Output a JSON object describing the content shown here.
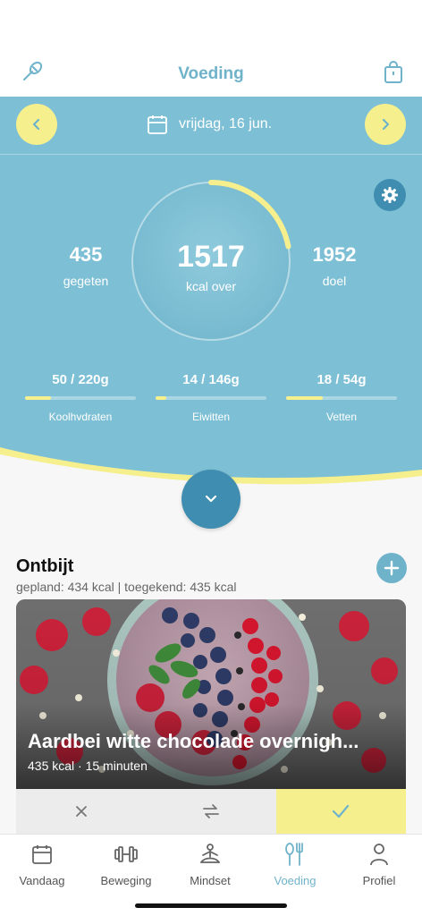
{
  "header": {
    "title": "Voeding",
    "left_icon": "whisk-icon",
    "right_icon": "shopping-bag-icon"
  },
  "date_nav": {
    "label": "vrijdag, 16 jun.",
    "prev_icon": "chevron-left-icon",
    "next_icon": "chevron-right-icon",
    "calendar_icon": "calendar-icon"
  },
  "summary": {
    "eaten_value": "435",
    "eaten_label": "gegeten",
    "remaining_value": "1517",
    "remaining_label": "kcal over",
    "goal_value": "1952",
    "goal_label": "doel",
    "progress_fraction": 0.22
  },
  "macros": [
    {
      "value": "50 / 220g",
      "label": "Koolhydraten",
      "fraction": 0.23
    },
    {
      "value": "14 / 146g",
      "label": "Eiwitten",
      "fraction": 0.1
    },
    {
      "value": "18 / 54g",
      "label": "Vetten",
      "fraction": 0.33
    }
  ],
  "meal": {
    "title": "Ontbijt",
    "subtitle": "gepland: 434 kcal | toegekend: 435 kcal",
    "recipe": {
      "title": "Aardbei witte chocolade overnigh...",
      "meta": "435 kcal · 15 minuten"
    }
  },
  "tabs": [
    {
      "label": "Vandaag",
      "icon": "calendar-icon"
    },
    {
      "label": "Beweging",
      "icon": "dumbbell-icon"
    },
    {
      "label": "Mindset",
      "icon": "meditation-icon"
    },
    {
      "label": "Voeding",
      "icon": "fork-knife-icon",
      "active": true
    },
    {
      "label": "Profiel",
      "icon": "person-icon"
    }
  ],
  "colors": {
    "accent": "#6fb3cb",
    "panel": "#7dbfd4",
    "highlight": "#f6ef8e",
    "dark_button": "#3f8db0"
  }
}
